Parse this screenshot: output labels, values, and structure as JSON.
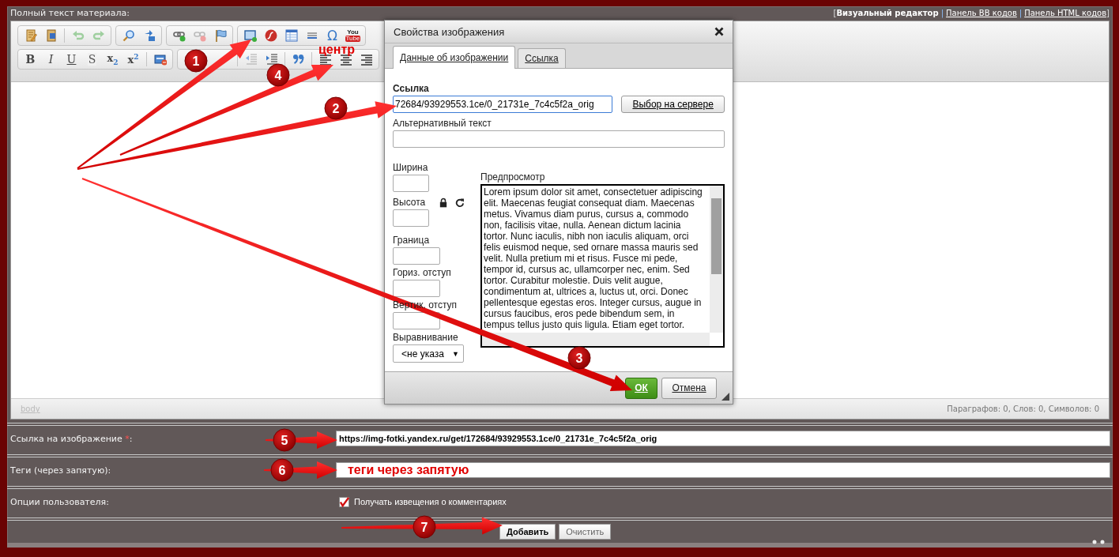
{
  "header": {
    "label": "Полный текст материала:",
    "bracket_open": "[",
    "separator": "|",
    "bracket_close": "]",
    "links": [
      {
        "text": "Визуальный редактор",
        "selected": true
      },
      {
        "text": "Панель BB кодов",
        "selected": false
      },
      {
        "text": "Панель HTML кодов",
        "selected": false
      }
    ]
  },
  "toolbar": {
    "row_1": [
      [
        {
          "kind": "template"
        },
        {
          "kind": "word"
        },
        {
          "kind": "divider"
        },
        {
          "kind": "undo"
        },
        {
          "kind": "redo"
        }
      ],
      [
        {
          "kind": "find"
        },
        {
          "kind": "replace"
        }
      ],
      [
        {
          "kind": "link"
        },
        {
          "kind": "unlink"
        },
        {
          "kind": "anchor"
        }
      ],
      [
        {
          "kind": "image"
        },
        {
          "kind": "flash"
        },
        {
          "kind": "table"
        },
        {
          "kind": "hline"
        },
        {
          "kind": "special",
          "text": "Ω"
        },
        {
          "kind": "youtube",
          "text": "You",
          "text_2": "Tube"
        }
      ]
    ],
    "row_2": [
      [
        {
          "kind": "bold",
          "text": "B"
        },
        {
          "kind": "italic",
          "text": "I"
        },
        {
          "kind": "underline",
          "text": "U"
        },
        {
          "kind": "strike",
          "text": "S"
        },
        {
          "kind": "subscript",
          "text": "x$_{2}$"
        },
        {
          "kind": "superscript",
          "text": "x$^{2}$"
        },
        {
          "kind": "divider"
        },
        {
          "kind": "html"
        }
      ],
      [
        {
          "kind": "spacer"
        },
        {
          "kind": "divider"
        },
        {
          "kind": "outdent"
        },
        {
          "kind": "indent"
        },
        {
          "kind": "divider"
        },
        {
          "kind": "quote"
        },
        {
          "kind": "divider"
        },
        {
          "kind": "align-left"
        },
        {
          "kind": "align-center"
        },
        {
          "kind": "align-right"
        }
      ]
    ]
  },
  "status_bar": {
    "path": "body",
    "counts": "Параграфов: 0, Слов: 0, Символов: 0"
  },
  "dialog": {
    "title": "Свойства изображения",
    "tabs": [
      {
        "label": "Данные об изображении",
        "selected": true
      },
      {
        "label": "Ссылка",
        "selected": false
      }
    ],
    "url": {
      "label": "Ссылка",
      "value": "72684/93929553.1ce/0_21731e_7c4c5f2a_orig"
    },
    "server_button": "Выбор на сервере",
    "alt": {
      "label": "Альтернативный текст"
    },
    "width": {
      "label": "Ширина"
    },
    "height": {
      "label": "Высота"
    },
    "border": {
      "label": "Граница"
    },
    "hspace": {
      "label": "Гориз. отступ"
    },
    "vspace": {
      "label": "Вертик. отступ"
    },
    "align": {
      "label": "Выравнивание",
      "value": "<не указа",
      "caret": "▼"
    },
    "preview": {
      "label": "Предпросмотр",
      "text": "Lorem ipsum dolor sit amet, consectetuer adipiscing elit. Maecenas feugiat consequat diam. Maecenas metus. Vivamus diam purus, cursus a, commodo non, facilisis vitae, nulla. Aenean dictum lacinia tortor. Nunc iaculis, nibh non iaculis aliquam, orci felis euismod neque, sed ornare massa mauris sed velit. Nulla pretium mi et risus. Fusce mi pede, tempor id, cursus ac, ullamcorper nec, enim. Sed tortor. Curabitur molestie. Duis velit augue, condimentum at, ultrices a, luctus ut, orci. Donec pellentesque egestas eros. Integer cursus, augue in cursus faucibus, eros pede bibendum sem, in tempus tellus justo quis ligula. Etiam eget tortor."
    },
    "ok_button": "ОК",
    "cancel_button": "Отмена"
  },
  "form": {
    "image_url": {
      "label": "Ссылка на изображение ",
      "required_mark": "*",
      "colon": ":",
      "value": "https://img-fotki.yandex.ru/get/172684/93929553.1ce/0_21731e_7c4c5f2a_orig"
    },
    "tags": {
      "label": "Теги (через запятую):",
      "value": "теги через запятую"
    },
    "options": {
      "label": "Опции пользователя:",
      "checkbox_label": "Получать извещения о комментариях",
      "checked": true
    },
    "buttons": [
      {
        "label": "Добавить",
        "primary": true
      },
      {
        "label": "Очистить",
        "primary": false
      }
    ]
  },
  "annotations": {
    "center_note": "центр",
    "markers": [
      "1",
      "4",
      "2",
      "3",
      "5",
      "6",
      "7"
    ]
  }
}
